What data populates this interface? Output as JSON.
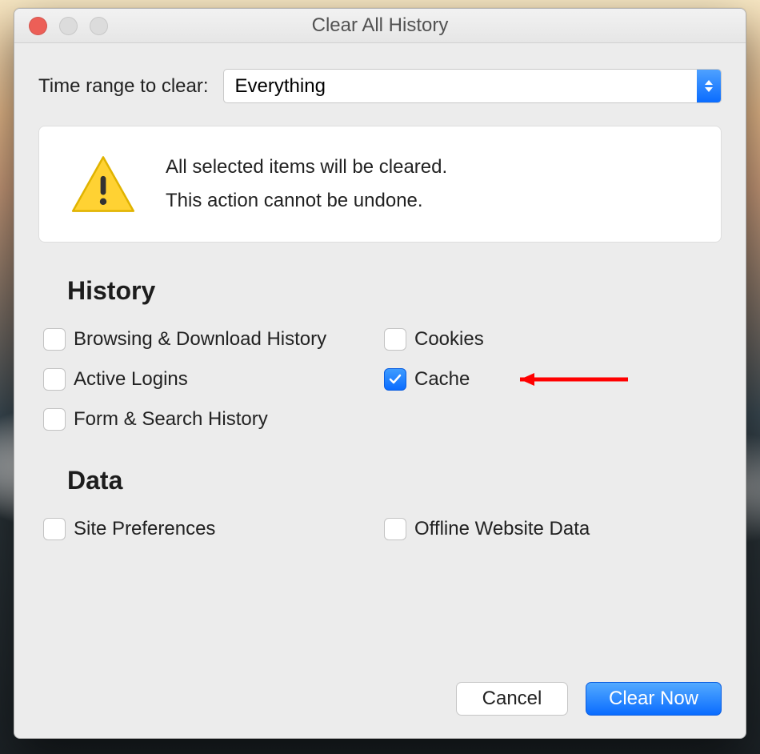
{
  "window": {
    "title": "Clear All History"
  },
  "range": {
    "label": "Time range to clear:",
    "selected": "Everything"
  },
  "warning": {
    "line1": "All selected items will be cleared.",
    "line2": "This action cannot be undone."
  },
  "sections": {
    "history": {
      "heading": "History",
      "items": [
        {
          "label": "Browsing & Download History",
          "checked": false
        },
        {
          "label": "Cookies",
          "checked": false
        },
        {
          "label": "Active Logins",
          "checked": false
        },
        {
          "label": "Cache",
          "checked": true
        },
        {
          "label": "Form & Search History",
          "checked": false
        }
      ]
    },
    "data": {
      "heading": "Data",
      "items": [
        {
          "label": "Site Preferences",
          "checked": false
        },
        {
          "label": "Offline Website Data",
          "checked": false
        }
      ]
    }
  },
  "buttons": {
    "cancel": "Cancel",
    "clear": "Clear Now"
  }
}
